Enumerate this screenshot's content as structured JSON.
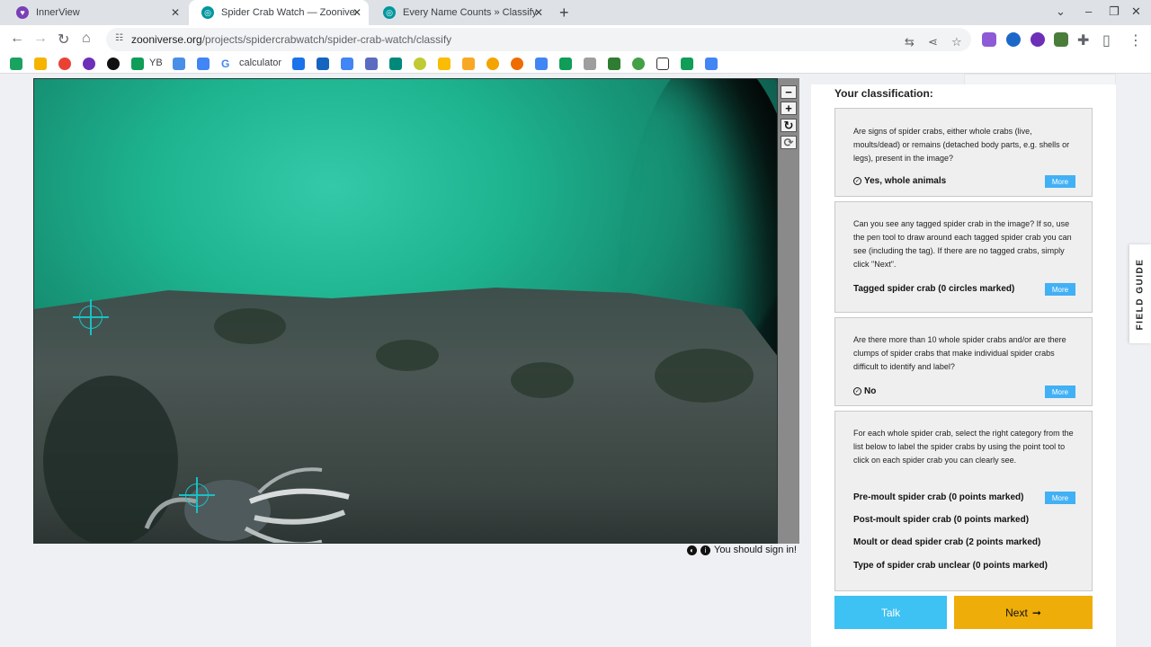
{
  "browser": {
    "tabs": [
      {
        "title": "InnerView",
        "active": false
      },
      {
        "title": "Spider Crab Watch — Zooniverse",
        "active": true
      },
      {
        "title": "Every Name Counts » Classify —",
        "active": false
      }
    ],
    "url_host": "zooniverse.org",
    "url_path": "/projects/spidercrabwatch/spider-crab-watch/classify",
    "bookmarks": {
      "yb": "YB",
      "calculator": "calculator"
    }
  },
  "viewer": {
    "zoom_out": "−",
    "zoom_in": "+",
    "rotate": "↻",
    "reset": "⟳",
    "signin_text": "You should sign in!"
  },
  "classification": {
    "heading": "Your classification:",
    "tasks": [
      {
        "question": "Are signs of spider crabs, either whole crabs (live, moults/dead) or remains (detached body parts, e.g. shells or legs), present in the image?",
        "answer": "Yes, whole animals",
        "more": "More"
      },
      {
        "question": "Can you see any tagged spider crab in the image? If so, use the pen tool to draw around each tagged spider crab you can see (including the tag). If there are no tagged crabs, simply click \"Next\".",
        "answer": "Tagged spider crab (0 circles marked)",
        "more": "More"
      },
      {
        "question": "Are there more than 10 whole spider crabs and/or are there clumps of spider crabs that make individual spider crabs difficult to identify and label?",
        "answer": "No",
        "more": "More"
      },
      {
        "question": "For each whole spider crab, select the right category from the list below to label the spider crabs by using the point tool to click on each spider crab you can clearly see.",
        "tools": [
          "Pre-moult spider crab (0 points marked)",
          "Post-moult spider crab (0 points marked)",
          "Moult or dead spider crab (2 points marked)",
          "Type of spider crab unclear (0 points marked)"
        ],
        "more": "More"
      }
    ],
    "talk_label": "Talk",
    "next_label": "Next"
  },
  "field_guide": "FIELD GUIDE",
  "colors": {
    "talk": "#3ec1f3",
    "next": "#efad0a",
    "more": "#42b0f5",
    "marker": "#19c0c4"
  }
}
